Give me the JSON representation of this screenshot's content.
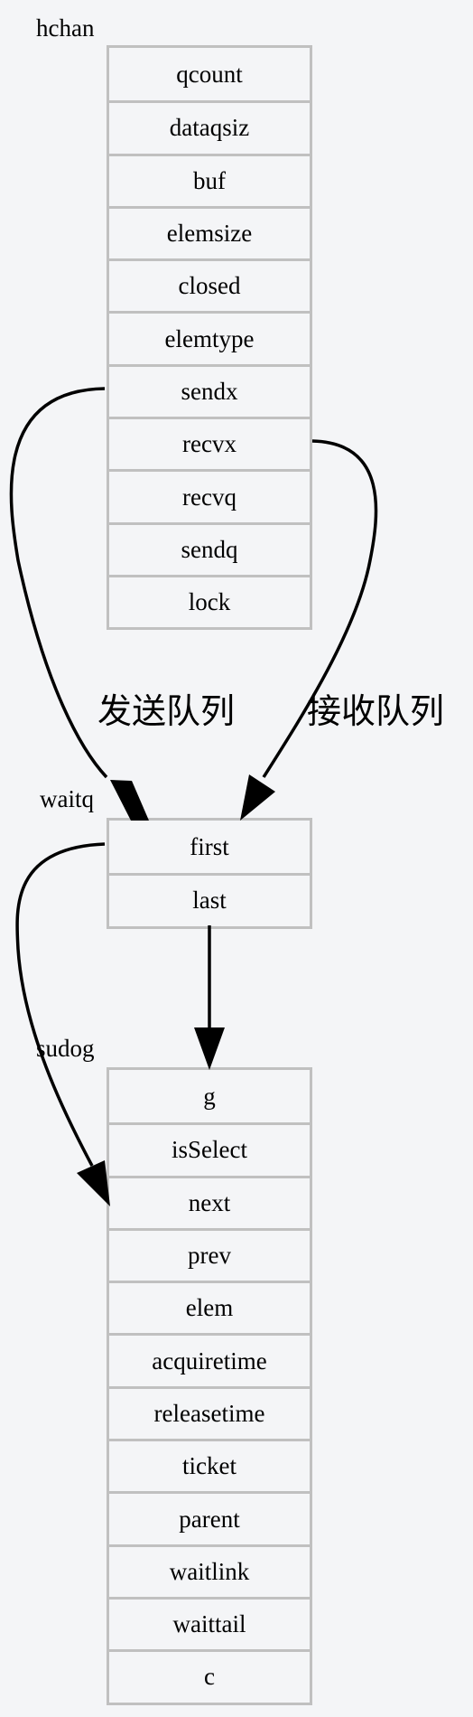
{
  "nodes": {
    "hchan": {
      "title": "hchan",
      "fields": [
        "qcount",
        "dataqsiz",
        "buf",
        "elemsize",
        "closed",
        "elemtype",
        "sendx",
        "recvx",
        "recvq",
        "sendq",
        "lock"
      ]
    },
    "waitq": {
      "title": "waitq",
      "fields": [
        "first",
        "last"
      ]
    },
    "sudog": {
      "title": "sudog",
      "fields": [
        "g",
        "isSelect",
        "next",
        "prev",
        "elem",
        "acquiretime",
        "releasetime",
        "ticket",
        "parent",
        "waitlink",
        "waittail",
        "c"
      ]
    }
  },
  "edges": [
    {
      "from": "hchan.sendx",
      "to": "waitq",
      "label": "发送队列"
    },
    {
      "from": "hchan.recvx",
      "to": "waitq",
      "label": "接收队列"
    },
    {
      "from": "waitq.first",
      "to": "sudog.next",
      "label": ""
    },
    {
      "from": "waitq.last",
      "to": "sudog",
      "label": ""
    }
  ],
  "colors": {
    "background": "#f4f5f7",
    "border": "#c0c0c0",
    "edge": "#000000"
  }
}
